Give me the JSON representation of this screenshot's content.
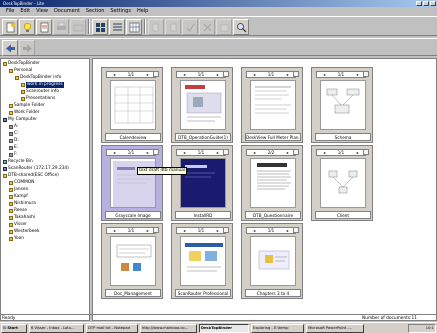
{
  "window": {
    "title": "DeskTopBinder - Lite"
  },
  "menu": [
    "File",
    "Edit",
    "View",
    "Document",
    "Section",
    "Settings",
    "Help"
  ],
  "tree": [
    {
      "label": "DeskTopBinder",
      "icon": "folder"
    },
    {
      "label": "Personal",
      "icon": "folder"
    },
    {
      "label": "DeskTopBinder info",
      "icon": "folder"
    },
    {
      "label": "work in progress",
      "icon": "folder"
    },
    {
      "label": "Scanrouter info",
      "icon": "folder"
    },
    {
      "label": "Presentations",
      "icon": "folder"
    },
    {
      "label": "Sample Folder",
      "icon": "folder"
    },
    {
      "label": "Work Folder",
      "icon": "folder"
    },
    {
      "label": "My Computer",
      "icon": "pc"
    },
    {
      "label": "A:",
      "icon": "drive"
    },
    {
      "label": "C:",
      "icon": "drive"
    },
    {
      "label": "D:",
      "icon": "drive"
    },
    {
      "label": "E:",
      "icon": "drive"
    },
    {
      "label": "F:",
      "icon": "drive"
    },
    {
      "label": "Recycle Bin",
      "icon": "bin"
    },
    {
      "label": "ScanRouter (172.17.29.234)",
      "icon": "pc"
    },
    {
      "label": "DTB-shared(ESC Office)",
      "icon": "folder"
    },
    {
      "label": "COMMON",
      "icon": "folder"
    },
    {
      "label": "Jansen",
      "icon": "folder"
    },
    {
      "label": "Kampf",
      "icon": "folder"
    },
    {
      "label": "Nishimura",
      "icon": "folder"
    },
    {
      "label": "Reese",
      "icon": "folder"
    },
    {
      "label": "Takahashi",
      "icon": "folder"
    },
    {
      "label": "Visser",
      "icon": "folder"
    },
    {
      "label": "Westerbeek",
      "icon": "folder"
    },
    {
      "label": "Yoon",
      "icon": "folder"
    }
  ],
  "cards": [
    {
      "page": "1/1",
      "caption": "Calendeview",
      "selected": false
    },
    {
      "page": "1/1",
      "caption": "DTB_OperationGuide(1)",
      "selected": false
    },
    {
      "page": "1/1",
      "caption": "DeskView Full Meter Plan...",
      "selected": false
    },
    {
      "page": "1/1",
      "caption": "Schema",
      "selected": false
    },
    {
      "page": "1/1",
      "caption": "Grayscale Image",
      "selected": true
    },
    {
      "page": "1/1",
      "caption": "InstallRD",
      "selected": false
    },
    {
      "page": "2/2",
      "caption": "DTB_Questionnaire",
      "selected": false
    },
    {
      "page": "1/1",
      "caption": "Client",
      "selected": false
    },
    {
      "page": "1/1",
      "caption": "Doc_Management",
      "selected": false
    },
    {
      "page": "1/1",
      "caption": "ScanRouter Professional",
      "selected": false
    },
    {
      "page": "1/1",
      "caption": "Chapters 3 to 4",
      "selected": false
    }
  ],
  "tooltip": "text draft dtb manual",
  "status": {
    "left": "Ready",
    "right": "Number of documents:11"
  },
  "taskbar": {
    "start": "Start",
    "items": [
      "6 Visser - Inbox - Lotu...",
      "DTP mail txt - Notepad",
      "http://www.mainboo.co...",
      "DeskTopBinder",
      "Exploring - E:\\temp",
      "Microsoft PowerPoint -..."
    ],
    "clock": "10:1"
  }
}
